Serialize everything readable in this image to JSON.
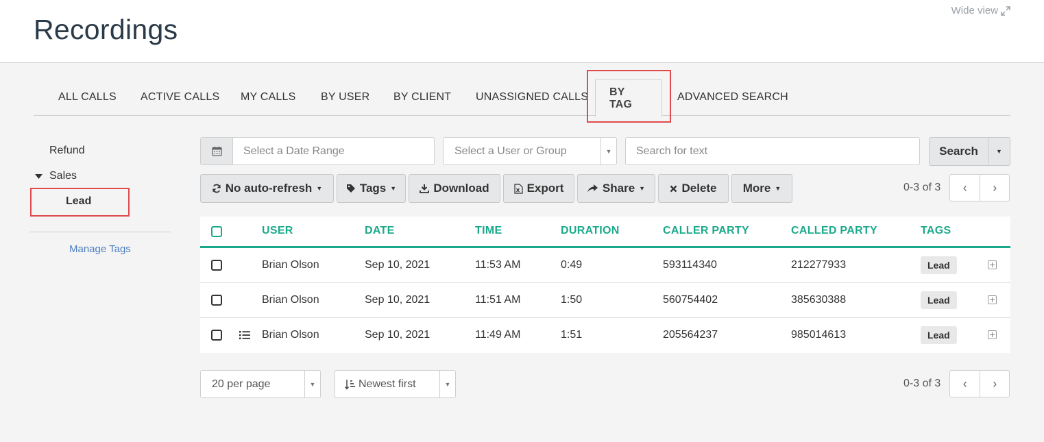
{
  "header": {
    "title": "Recordings",
    "wide_view_label": "Wide view"
  },
  "tabs": [
    {
      "label": "ALL CALLS"
    },
    {
      "label": "ACTIVE CALLS"
    },
    {
      "label": "MY CALLS"
    },
    {
      "label": "BY USER"
    },
    {
      "label": "BY CLIENT"
    },
    {
      "label": "UNASSIGNED CALLS"
    },
    {
      "label": "BY TAG",
      "active": true
    },
    {
      "label": "ADVANCED SEARCH"
    }
  ],
  "sidebar": {
    "items": [
      {
        "label": "Refund"
      },
      {
        "label": "Sales"
      },
      {
        "label": "Lead",
        "selected": true
      }
    ],
    "manage_tags": "Manage Tags"
  },
  "filters": {
    "date_range_placeholder": "Select a Date Range",
    "user_group_placeholder": "Select a User or Group",
    "search_text_placeholder": "Search for text",
    "search_button": "Search"
  },
  "toolbar": {
    "auto_refresh": "No auto-refresh",
    "tags": "Tags",
    "download": "Download",
    "export": "Export",
    "share": "Share",
    "delete": "Delete",
    "more": "More"
  },
  "pagination": {
    "count_top": "0-3 of 3",
    "count_bottom": "0-3 of 3",
    "per_page": "20 per page",
    "sort": "Newest first"
  },
  "table": {
    "columns": [
      "USER",
      "DATE",
      "TIME",
      "DURATION",
      "CALLER PARTY",
      "CALLED PARTY",
      "TAGS"
    ],
    "rows": [
      {
        "user": "Brian Olson",
        "date": "Sep 10, 2021",
        "time": "11:53 AM",
        "duration": "0:49",
        "caller": "593114340",
        "called": "212277933",
        "tag": "Lead"
      },
      {
        "user": "Brian Olson",
        "date": "Sep 10, 2021",
        "time": "11:51 AM",
        "duration": "1:50",
        "caller": "560754402",
        "called": "385630388",
        "tag": "Lead"
      },
      {
        "user": "Brian Olson",
        "date": "Sep 10, 2021",
        "time": "11:49 AM",
        "duration": "1:51",
        "caller": "205564237",
        "called": "985014613",
        "tag": "Lead"
      }
    ]
  },
  "colors": {
    "accent": "#1aa98a",
    "highlight": "#e04a4a",
    "link": "#4d7ebf"
  }
}
